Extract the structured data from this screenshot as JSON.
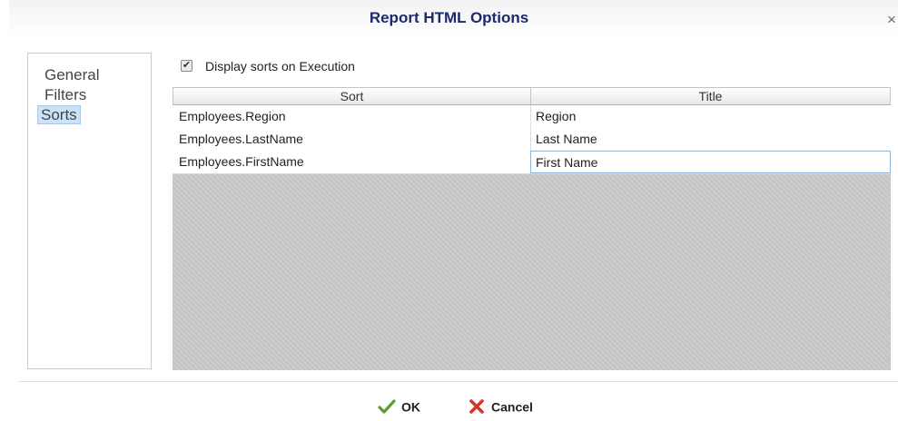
{
  "dialog": {
    "title": "Report HTML Options",
    "close_glyph": "×"
  },
  "nav": {
    "items": [
      {
        "label": "General",
        "selected": false
      },
      {
        "label": "Filters",
        "selected": false
      },
      {
        "label": "Sorts",
        "selected": true
      }
    ]
  },
  "options": {
    "display_sorts_label": "Display sorts on Execution",
    "display_sorts_checked": true,
    "check_glyph": "✔"
  },
  "grid": {
    "columns": [
      "Sort",
      "Title"
    ],
    "rows": [
      {
        "sort": "Employees.Region",
        "title": "Region"
      },
      {
        "sort": "Employees.LastName",
        "title": "Last Name"
      },
      {
        "sort": "Employees.FirstName",
        "title": "First Name"
      }
    ]
  },
  "buttons": {
    "ok": {
      "label": "OK",
      "icon": "check-icon",
      "color": "#5aa02c"
    },
    "cancel": {
      "label": "Cancel",
      "icon": "x-icon",
      "color": "#d9342b"
    }
  }
}
